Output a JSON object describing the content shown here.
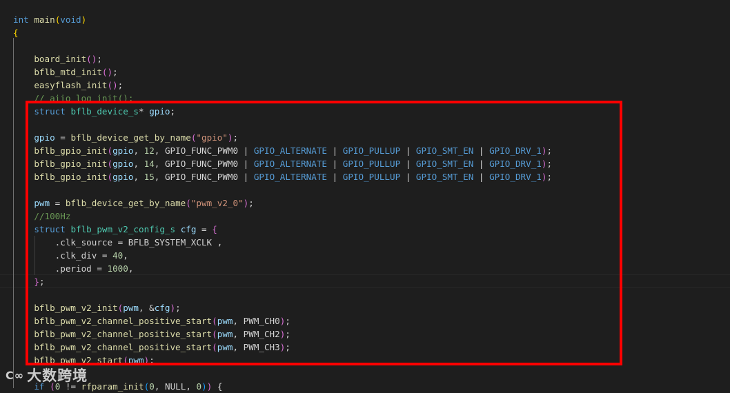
{
  "editor": {
    "theme": {
      "background": "#1e1e1e",
      "highlight_box_color": "#ff0000"
    },
    "lines": [
      [
        [
          "keyword",
          "int"
        ],
        [
          "plain",
          " "
        ],
        [
          "function",
          "main"
        ],
        [
          "paren2",
          "("
        ],
        [
          "keyword",
          "void"
        ],
        [
          "paren2",
          ")"
        ]
      ],
      [
        [
          "paren2",
          "{"
        ]
      ],
      [],
      [
        [
          "plain",
          "    "
        ],
        [
          "function",
          "board_init"
        ],
        [
          "paren",
          "()"
        ],
        [
          "plain",
          ";"
        ]
      ],
      [
        [
          "plain",
          "    "
        ],
        [
          "function",
          "bflb_mtd_init"
        ],
        [
          "paren",
          "()"
        ],
        [
          "plain",
          ";"
        ]
      ],
      [
        [
          "plain",
          "    "
        ],
        [
          "function",
          "easyflash_init"
        ],
        [
          "paren",
          "()"
        ],
        [
          "plain",
          ";"
        ]
      ],
      [
        [
          "plain",
          "    "
        ],
        [
          "comment",
          "// aiio_log_init();"
        ]
      ],
      [
        [
          "plain",
          "    "
        ],
        [
          "keyword",
          "struct"
        ],
        [
          "plain",
          " "
        ],
        [
          "type",
          "bflb_device_s"
        ],
        [
          "plain",
          "* "
        ],
        [
          "variable",
          "gpio"
        ],
        [
          "plain",
          ";"
        ]
      ],
      [],
      [
        [
          "plain",
          "    "
        ],
        [
          "variable",
          "gpio"
        ],
        [
          "plain",
          " = "
        ],
        [
          "function",
          "bflb_device_get_by_name"
        ],
        [
          "paren",
          "("
        ],
        [
          "string",
          "\"gpio\""
        ],
        [
          "paren",
          ")"
        ],
        [
          "plain",
          ";"
        ]
      ],
      [
        [
          "plain",
          "    "
        ],
        [
          "function",
          "bflb_gpio_init"
        ],
        [
          "paren",
          "("
        ],
        [
          "variable",
          "gpio"
        ],
        [
          "plain",
          ", "
        ],
        [
          "number",
          "12"
        ],
        [
          "plain",
          ", GPIO_FUNC_PWM0 | "
        ],
        [
          "macro",
          "GPIO_ALTERNATE"
        ],
        [
          "plain",
          " | "
        ],
        [
          "macro",
          "GPIO_PULLUP"
        ],
        [
          "plain",
          " | "
        ],
        [
          "macro",
          "GPIO_SMT_EN"
        ],
        [
          "plain",
          " | "
        ],
        [
          "macro",
          "GPIO_DRV_1"
        ],
        [
          "paren",
          ")"
        ],
        [
          "plain",
          ";"
        ]
      ],
      [
        [
          "plain",
          "    "
        ],
        [
          "function",
          "bflb_gpio_init"
        ],
        [
          "paren",
          "("
        ],
        [
          "variable",
          "gpio"
        ],
        [
          "plain",
          ", "
        ],
        [
          "number",
          "14"
        ],
        [
          "plain",
          ", GPIO_FUNC_PWM0 | "
        ],
        [
          "macro",
          "GPIO_ALTERNATE"
        ],
        [
          "plain",
          " | "
        ],
        [
          "macro",
          "GPIO_PULLUP"
        ],
        [
          "plain",
          " | "
        ],
        [
          "macro",
          "GPIO_SMT_EN"
        ],
        [
          "plain",
          " | "
        ],
        [
          "macro",
          "GPIO_DRV_1"
        ],
        [
          "paren",
          ")"
        ],
        [
          "plain",
          ";"
        ]
      ],
      [
        [
          "plain",
          "    "
        ],
        [
          "function",
          "bflb_gpio_init"
        ],
        [
          "paren",
          "("
        ],
        [
          "variable",
          "gpio"
        ],
        [
          "plain",
          ", "
        ],
        [
          "number",
          "15"
        ],
        [
          "plain",
          ", GPIO_FUNC_PWM0 | "
        ],
        [
          "macro",
          "GPIO_ALTERNATE"
        ],
        [
          "plain",
          " | "
        ],
        [
          "macro",
          "GPIO_PULLUP"
        ],
        [
          "plain",
          " | "
        ],
        [
          "macro",
          "GPIO_SMT_EN"
        ],
        [
          "plain",
          " | "
        ],
        [
          "macro",
          "GPIO_DRV_1"
        ],
        [
          "paren",
          ")"
        ],
        [
          "plain",
          ";"
        ]
      ],
      [],
      [
        [
          "plain",
          "    "
        ],
        [
          "variable",
          "pwm"
        ],
        [
          "plain",
          " = "
        ],
        [
          "function",
          "bflb_device_get_by_name"
        ],
        [
          "paren",
          "("
        ],
        [
          "string",
          "\"pwm_v2_0\""
        ],
        [
          "paren",
          ")"
        ],
        [
          "plain",
          ";"
        ]
      ],
      [
        [
          "plain",
          "    "
        ],
        [
          "comment",
          "//100Hz"
        ]
      ],
      [
        [
          "plain",
          "    "
        ],
        [
          "keyword",
          "struct"
        ],
        [
          "plain",
          " "
        ],
        [
          "type",
          "bflb_pwm_v2_config_s"
        ],
        [
          "plain",
          " "
        ],
        [
          "variable",
          "cfg"
        ],
        [
          "plain",
          " = "
        ],
        [
          "paren",
          "{"
        ]
      ],
      [
        [
          "plain",
          "        .clk_source = BFLB_SYSTEM_XCLK ,"
        ]
      ],
      [
        [
          "plain",
          "        .clk_div = "
        ],
        [
          "number",
          "40"
        ],
        [
          "plain",
          ","
        ]
      ],
      [
        [
          "plain",
          "        .period = "
        ],
        [
          "number",
          "1000"
        ],
        [
          "plain",
          ","
        ]
      ],
      [
        [
          "plain",
          "    "
        ],
        [
          "paren",
          "}"
        ],
        [
          "plain",
          ";"
        ]
      ],
      [],
      [
        [
          "plain",
          "    "
        ],
        [
          "function",
          "bflb_pwm_v2_init"
        ],
        [
          "paren",
          "("
        ],
        [
          "variable",
          "pwm"
        ],
        [
          "plain",
          ", &"
        ],
        [
          "variable",
          "cfg"
        ],
        [
          "paren",
          ")"
        ],
        [
          "plain",
          ";"
        ]
      ],
      [
        [
          "plain",
          "    "
        ],
        [
          "function",
          "bflb_pwm_v2_channel_positive_start"
        ],
        [
          "paren",
          "("
        ],
        [
          "variable",
          "pwm"
        ],
        [
          "plain",
          ", PWM_CH0"
        ],
        [
          "paren",
          ")"
        ],
        [
          "plain",
          ";"
        ]
      ],
      [
        [
          "plain",
          "    "
        ],
        [
          "function",
          "bflb_pwm_v2_channel_positive_start"
        ],
        [
          "paren",
          "("
        ],
        [
          "variable",
          "pwm"
        ],
        [
          "plain",
          ", PWM_CH2"
        ],
        [
          "paren",
          ")"
        ],
        [
          "plain",
          ";"
        ]
      ],
      [
        [
          "plain",
          "    "
        ],
        [
          "function",
          "bflb_pwm_v2_channel_positive_start"
        ],
        [
          "paren",
          "("
        ],
        [
          "variable",
          "pwm"
        ],
        [
          "plain",
          ", PWM_CH3"
        ],
        [
          "paren",
          ")"
        ],
        [
          "plain",
          ";"
        ]
      ],
      [
        [
          "plain",
          "    "
        ],
        [
          "function",
          "bflb_pwm_v2_start"
        ],
        [
          "paren",
          "("
        ],
        [
          "variable",
          "pwm"
        ],
        [
          "paren",
          ")"
        ],
        [
          "plain",
          ";"
        ]
      ],
      [],
      [
        [
          "plain",
          "    "
        ],
        [
          "keyword",
          "if"
        ],
        [
          "plain",
          " "
        ],
        [
          "paren",
          "("
        ],
        [
          "number",
          "0"
        ],
        [
          "plain",
          " != "
        ],
        [
          "function",
          "rfparam_init"
        ],
        [
          "paren3",
          "("
        ],
        [
          "number",
          "0"
        ],
        [
          "plain",
          ", NULL, "
        ],
        [
          "number",
          "0"
        ],
        [
          "paren3",
          ")"
        ],
        [
          "paren",
          ")"
        ],
        [
          "plain",
          " {"
        ]
      ]
    ]
  },
  "watermark": {
    "logo": "C∞",
    "text": "大数跨境"
  }
}
